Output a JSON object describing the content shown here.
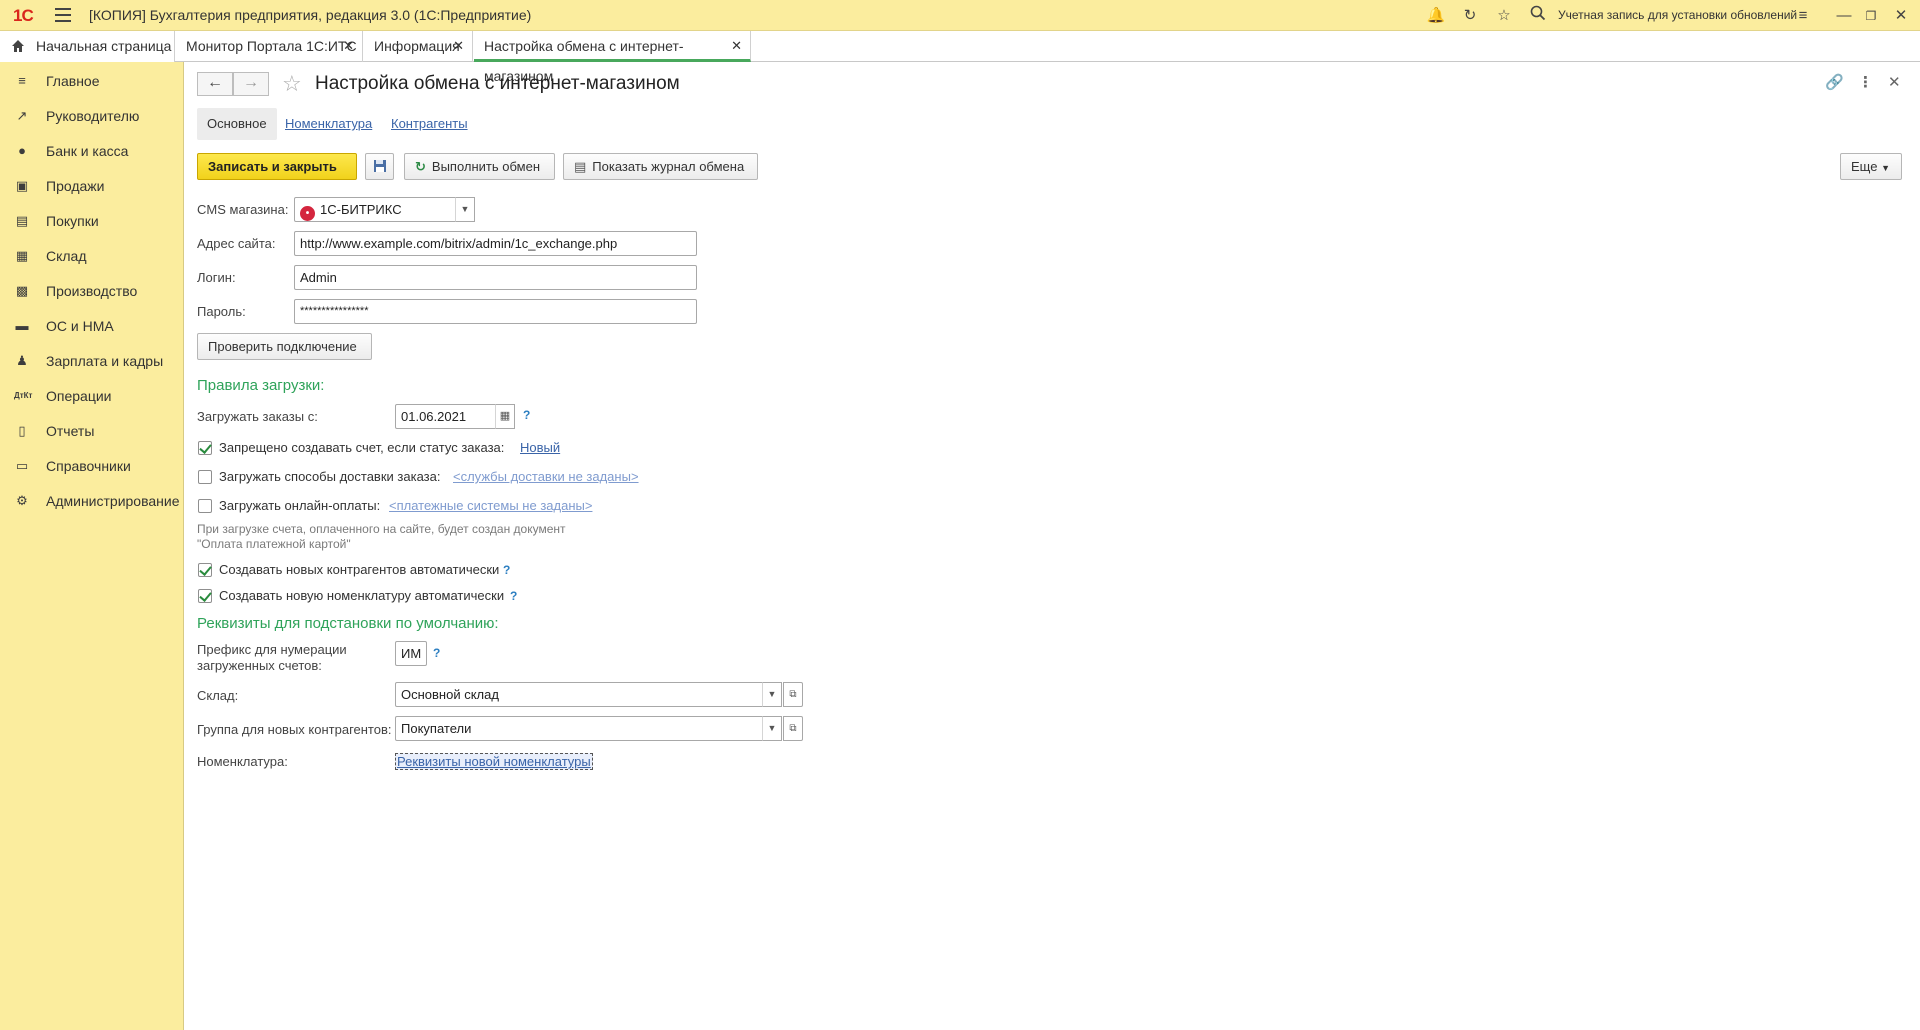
{
  "window": {
    "logo": "1С",
    "title": "[КОПИЯ] Бухгалтерия предприятия, редакция 3.0  (1С:Предприятие)",
    "account_text": "Учетная запись для установки обновлений",
    "icons": [
      "bell-icon",
      "history-icon",
      "star-icon",
      "search-icon",
      "menu-icon",
      "minimize-icon",
      "restore-icon",
      "close-icon"
    ]
  },
  "tabs": {
    "home": "Начальная страница",
    "items": [
      {
        "label": "Монитор Портала 1С:ИТС"
      },
      {
        "label": "Информация"
      },
      {
        "label": "Настройка обмена с интернет-магазином"
      }
    ]
  },
  "sidebar": {
    "items": [
      {
        "label": "Главное",
        "icon": "menu-icon"
      },
      {
        "label": "Руководителю",
        "icon": "trend-icon"
      },
      {
        "label": "Банк и касса",
        "icon": "coin-icon"
      },
      {
        "label": "Продажи",
        "icon": "bag-icon"
      },
      {
        "label": "Покупки",
        "icon": "cart-icon"
      },
      {
        "label": "Склад",
        "icon": "warehouse-icon"
      },
      {
        "label": "Производство",
        "icon": "factory-icon"
      },
      {
        "label": "ОС и НМА",
        "icon": "truck-icon"
      },
      {
        "label": "Зарплата и кадры",
        "icon": "person-icon"
      },
      {
        "label": "Операции",
        "icon": "dt-kt-icon"
      },
      {
        "label": "Отчеты",
        "icon": "bar-chart-icon"
      },
      {
        "label": "Справочники",
        "icon": "books-icon"
      },
      {
        "label": "Администрирование",
        "icon": "gear-icon"
      }
    ]
  },
  "form": {
    "title": "Настройка обмена с интернет-магазином",
    "tabs": [
      "Основное",
      "Номенклатура",
      "Контрагенты"
    ],
    "toolbar": {
      "save_close": "Записать и закрыть",
      "run_exchange": "Выполнить обмен",
      "show_log": "Показать журнал обмена",
      "more": "Еще"
    },
    "fields": {
      "cms_label": "CMS магазина:",
      "cms_value": "1С-БИТРИКС",
      "site_label": "Адрес сайта:",
      "site_value": "http://www.example.com/bitrix/admin/1c_exchange.php",
      "login_label": "Логин:",
      "login_value": "Admin",
      "password_label": "Пароль:",
      "password_value": "****************",
      "check_button": "Проверить подключение"
    },
    "rules": {
      "heading": "Правила загрузки:",
      "orders_from_label": "Загружать заказы с:",
      "orders_from_value": "01.06.2021",
      "forbid_invoice_label": "Запрещено создавать счет, если статус заказа:",
      "forbid_invoice_checked": true,
      "forbid_invoice_status": "Новый",
      "delivery_label": "Загружать способы доставки заказа:",
      "delivery_checked": false,
      "delivery_link": "<службы доставки не заданы>",
      "payments_label": "Загружать онлайн-оплаты:",
      "payments_checked": false,
      "payments_link": "<платежные системы не заданы>",
      "payments_note": "При загрузке счета, оплаченного на сайте, будет создан документ \"Оплата платежной картой\"",
      "auto_contractors_label": "Создавать новых контрагентов автоматически",
      "auto_contractors_checked": true,
      "auto_nomenclature_label": "Создавать новую номенклатуру автоматически",
      "auto_nomenclature_checked": true
    },
    "defaults": {
      "heading": "Реквизиты для подстановки по умолчанию:",
      "prefix_label_1": "Префикс для нумерации",
      "prefix_label_2": "загруженных счетов:",
      "prefix_value": "ИМ",
      "warehouse_label": "Склад:",
      "warehouse_value": "Основной склад",
      "group_label": "Группа для новых контрагентов:",
      "group_value": "Покупатели",
      "nomenclature_label": "Номенклатура:",
      "nomenclature_link": "Реквизиты новой номенклатуры"
    }
  }
}
